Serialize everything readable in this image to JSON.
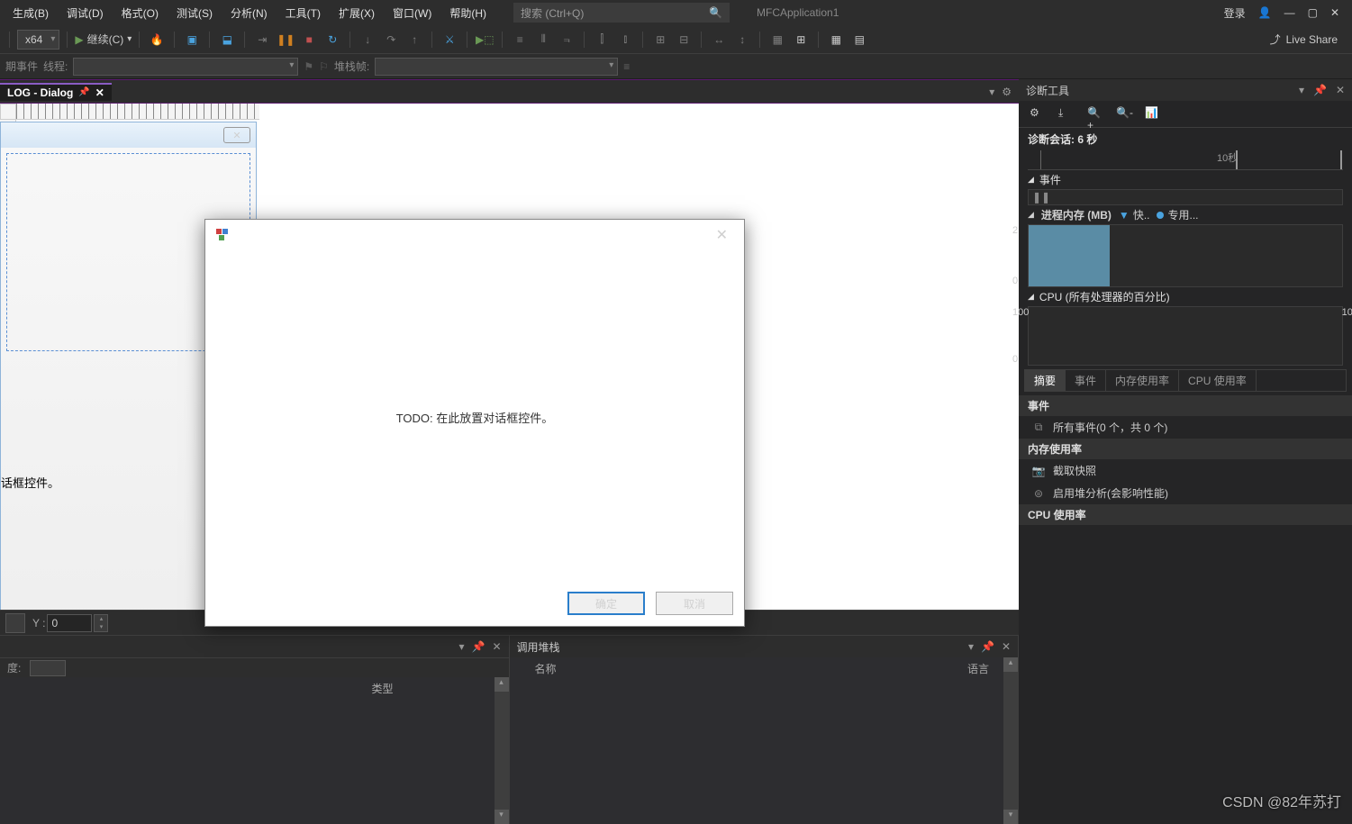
{
  "menu": {
    "items": [
      "生成(B)",
      "调试(D)",
      "格式(O)",
      "测试(S)",
      "分析(N)",
      "工具(T)",
      "扩展(X)",
      "窗口(W)",
      "帮助(H)"
    ],
    "search_placeholder": "搜索 (Ctrl+Q)",
    "app_title": "MFCApplication1",
    "login": "登录"
  },
  "toolbar": {
    "config": "x64",
    "continue": "继续(C)",
    "live_share": "Live Share"
  },
  "toolbar2": {
    "lifecycle": "期事件",
    "thread": "线程:",
    "stack": "堆栈帧:"
  },
  "doc": {
    "tab": "LOG - Dialog"
  },
  "designer": {
    "placeholder_text": "话框控件。",
    "ok": "确定",
    "cancel": "取消"
  },
  "coord": {
    "y_label": "Y :",
    "y_value": "0"
  },
  "bottom": {
    "left": {
      "width_label": "度:",
      "type_col": "类型"
    },
    "right": {
      "title": "调用堆栈",
      "name_col": "名称",
      "lang_col": "语言"
    }
  },
  "diag": {
    "title": "诊断工具",
    "session": "诊断会话: 6 秒",
    "time_label": "10秒",
    "events": "事件",
    "memory": "进程内存 (MB)",
    "snapshot": "快..",
    "private": "专用...",
    "cpu": "CPU (所有处理器的百分比)",
    "tabs": [
      "摘要",
      "事件",
      "内存使用率",
      "CPU 使用率"
    ],
    "groups": {
      "events": "事件",
      "memory": "内存使用率",
      "cpu": "CPU 使用率"
    },
    "items": {
      "all_events": "所有事件(0 个，共 0 个)",
      "snapshot_btn": "截取快照",
      "heap": "启用堆分析(会影响性能)"
    }
  },
  "chart_data": [
    {
      "type": "area",
      "title": "进程内存 (MB)",
      "ylim": [
        0,
        2
      ],
      "x_range": [
        0,
        10
      ],
      "series": [
        {
          "name": "专用",
          "values": [
            2,
            2,
            2,
            2,
            2
          ],
          "x": [
            0,
            1,
            2,
            3,
            3.5
          ]
        }
      ],
      "y_ticks": [
        0,
        2
      ]
    },
    {
      "type": "line",
      "title": "CPU (所有处理器的百分比)",
      "ylim": [
        0,
        100
      ],
      "x_range": [
        0,
        10
      ],
      "series": [
        {
          "name": "CPU",
          "values": [
            0,
            0,
            0,
            0
          ],
          "x": [
            0,
            3,
            6,
            10
          ]
        }
      ],
      "y_ticks": [
        0,
        100
      ]
    }
  ],
  "native_dialog": {
    "body": "TODO: 在此放置对话框控件。",
    "ok": "确定",
    "cancel": "取消"
  },
  "watermark": "CSDN @82年苏打"
}
